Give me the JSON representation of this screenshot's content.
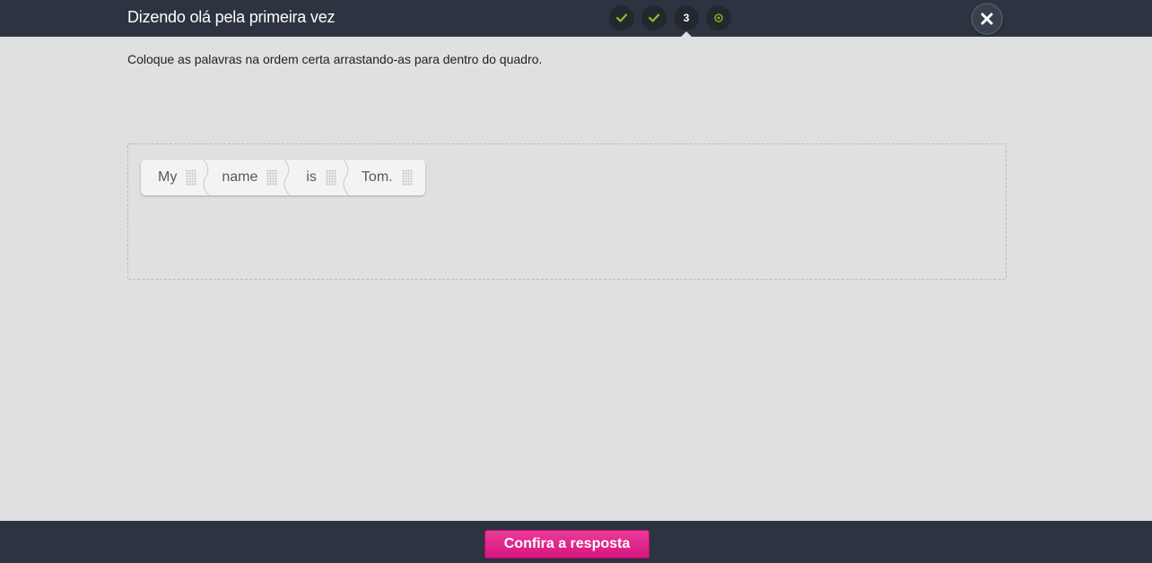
{
  "header": {
    "title": "Dizendo olá pela primeira vez",
    "steps": [
      {
        "state": "done",
        "icon": "check-icon"
      },
      {
        "state": "done",
        "icon": "check-icon"
      },
      {
        "state": "current",
        "label": "3"
      },
      {
        "state": "pending",
        "icon": "target-icon"
      }
    ],
    "close_icon": "close-icon"
  },
  "exercise": {
    "instruction": "Coloque as palavras na ordem certa arrastando-as para dentro do quadro.",
    "words": [
      "My",
      "name",
      "is",
      "Tom."
    ]
  },
  "footer": {
    "confirm_label": "Confira a resposta"
  },
  "colors": {
    "background": "#dfe0e2",
    "bar": "#2d3340",
    "check": "#8dc21f",
    "accent": "#e0248a"
  }
}
